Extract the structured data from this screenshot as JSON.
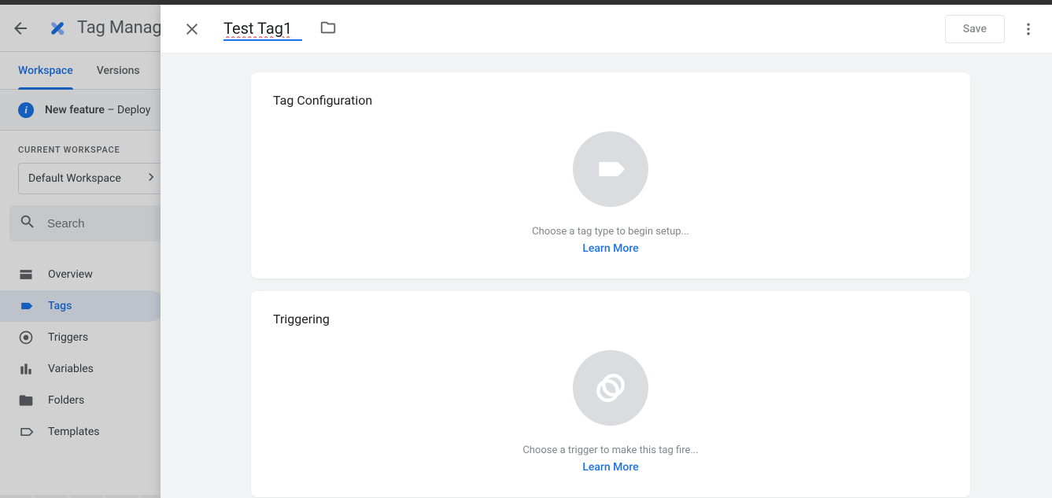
{
  "header": {
    "app_title": "Tag Manage",
    "back_aria": "Back"
  },
  "tabs": {
    "workspace": "Workspace",
    "versions": "Versions"
  },
  "banner": {
    "label_bold": "New feature",
    "label_rest": " – Deploy"
  },
  "workspace": {
    "section_label": "CURRENT WORKSPACE",
    "current_name": "Default Workspace"
  },
  "search": {
    "placeholder": "Search"
  },
  "nav": {
    "overview": "Overview",
    "tags": "Tags",
    "triggers": "Triggers",
    "variables": "Variables",
    "folders": "Folders",
    "templates": "Templates"
  },
  "panel": {
    "tag_name": "Test Tag1",
    "save": "Save",
    "cards": {
      "config": {
        "title": "Tag Configuration",
        "hint": "Choose a tag type to begin setup...",
        "link": "Learn More"
      },
      "trigger": {
        "title": "Triggering",
        "hint": "Choose a trigger to make this tag fire...",
        "link": "Learn More"
      }
    }
  }
}
